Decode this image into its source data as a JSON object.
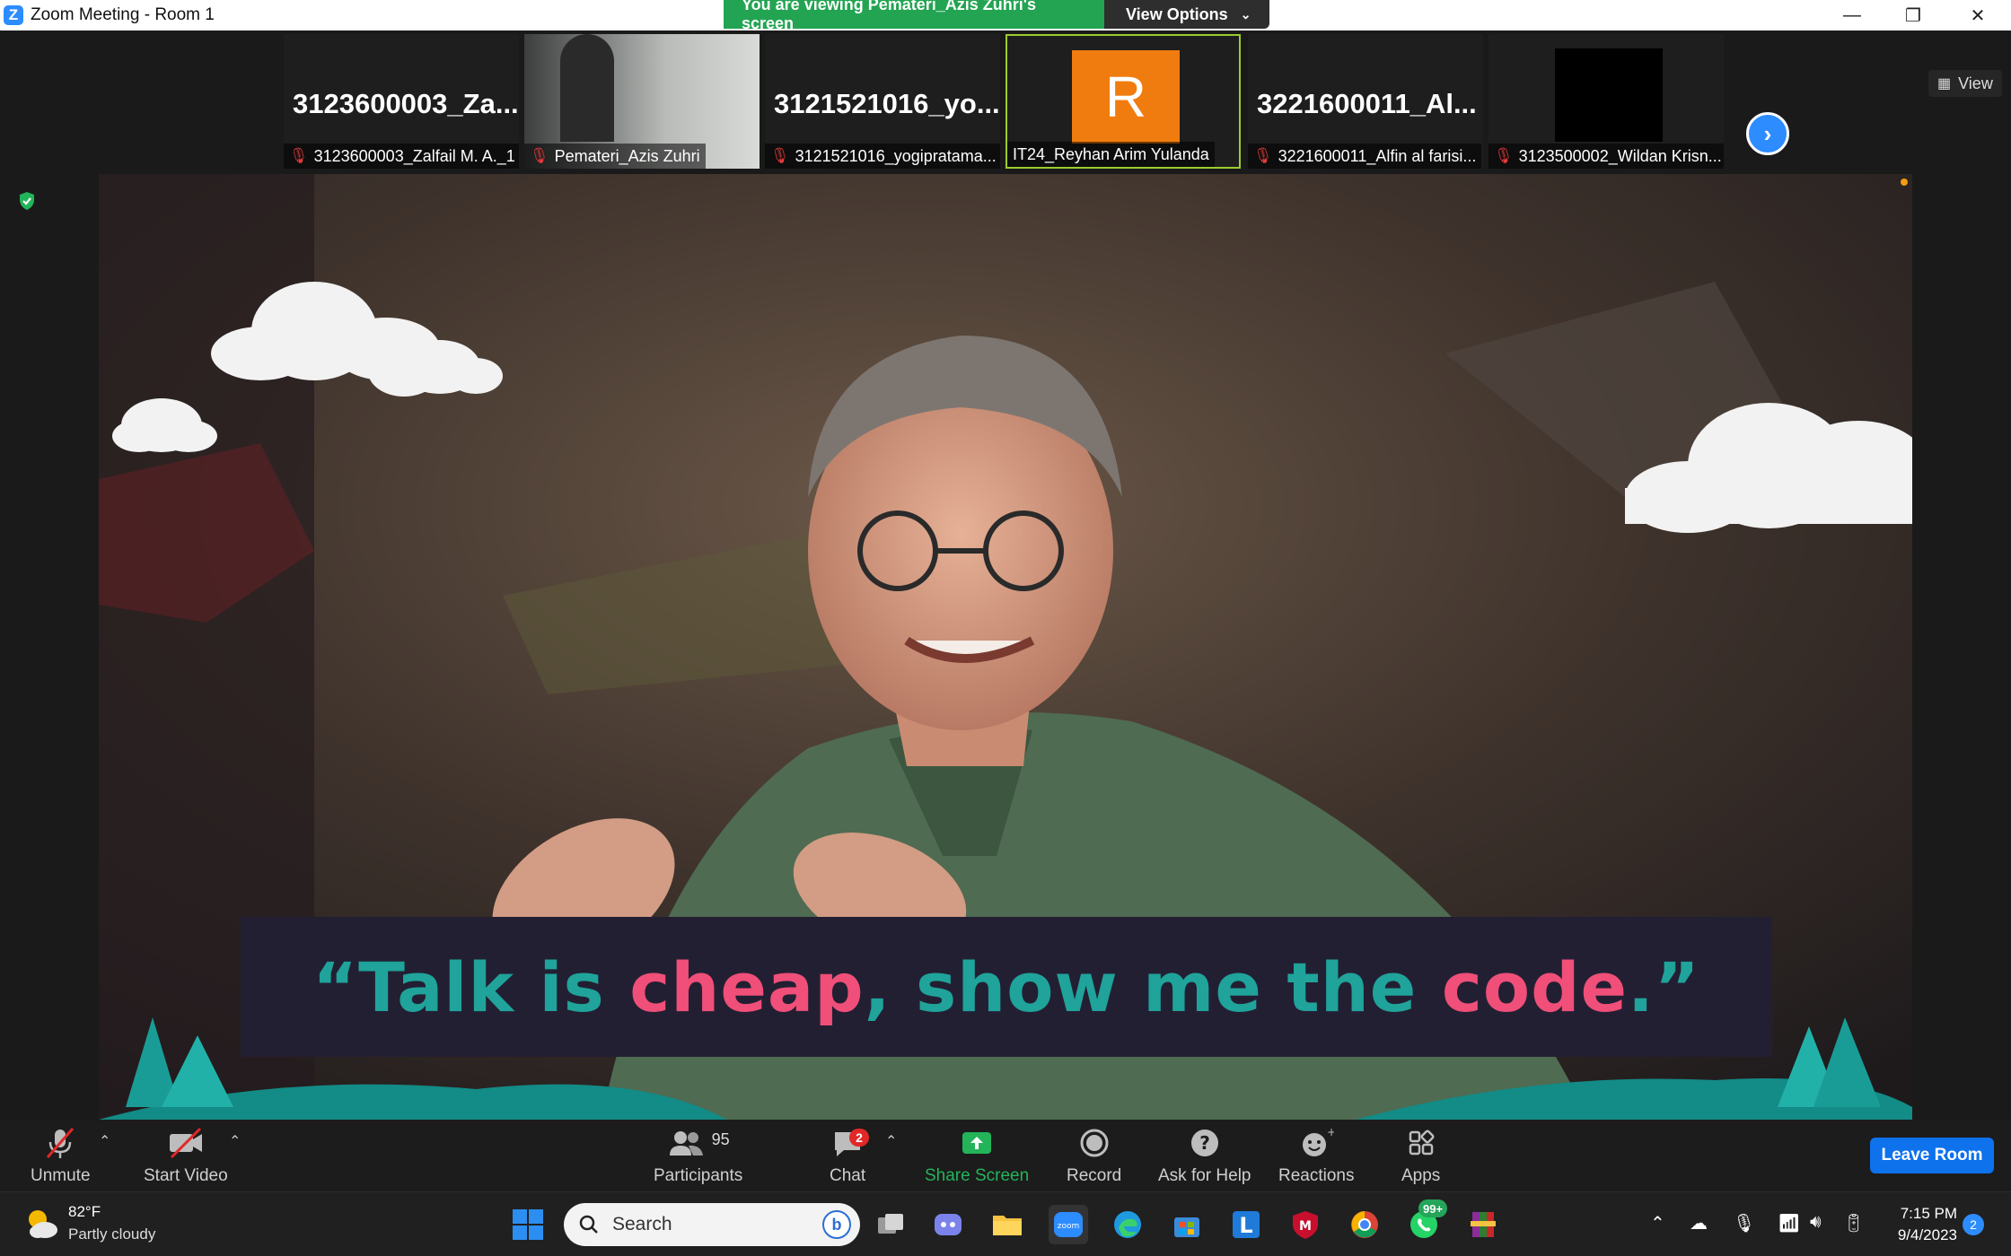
{
  "window": {
    "title": "Zoom Meeting - Room 1",
    "logo": "Z"
  },
  "banner": {
    "viewing": "You are viewing Pemateri_Azis Zuhri's screen",
    "options": "View Options"
  },
  "window_controls": {
    "minimize": "—",
    "restore": "❐",
    "close": "✕"
  },
  "participants_strip": [
    {
      "big_name": "3123600003_Za...",
      "label": "3123600003_Zalfail M. A._1",
      "muted": true
    },
    {
      "big_name": "",
      "label": "Pemateri_Azis Zuhri",
      "muted": true,
      "video": true
    },
    {
      "big_name": "3121521016_yo...",
      "label": "3121521016_yogipratama...",
      "muted": true
    },
    {
      "big_name": "",
      "label": "IT24_Reyhan Arim Yulanda",
      "muted": false,
      "avatar_letter": "R",
      "avatar_color": "#f07c0f",
      "active": true
    },
    {
      "big_name": "3221600011_Al...",
      "label": "3221600011_Alfin al farisi...",
      "muted": true
    },
    {
      "big_name": "",
      "label": "3123500002_Wildan Krisn...",
      "muted": true,
      "black_video": true
    }
  ],
  "view_button": "View",
  "shared_screen": {
    "quote_parts": [
      "“Talk is ",
      "cheap",
      ", show me the ",
      "code",
      ".”"
    ],
    "teal": "#1fa39a",
    "pink": "#ef4f78"
  },
  "toolbar": {
    "unmute": "Unmute",
    "start_video": "Start Video",
    "participants": "Participants",
    "participants_count": "95",
    "chat": "Chat",
    "chat_badge": "2",
    "share_screen": "Share Screen",
    "record": "Record",
    "ask_help": "Ask for Help",
    "reactions": "Reactions",
    "apps": "Apps",
    "leave": "Leave Room"
  },
  "taskbar": {
    "temp": "82°F",
    "weather": "Partly cloudy",
    "search": "Search",
    "whatsapp_badge": "99+",
    "time": "7:15 PM",
    "date": "9/4/2023",
    "notifications": "2"
  }
}
